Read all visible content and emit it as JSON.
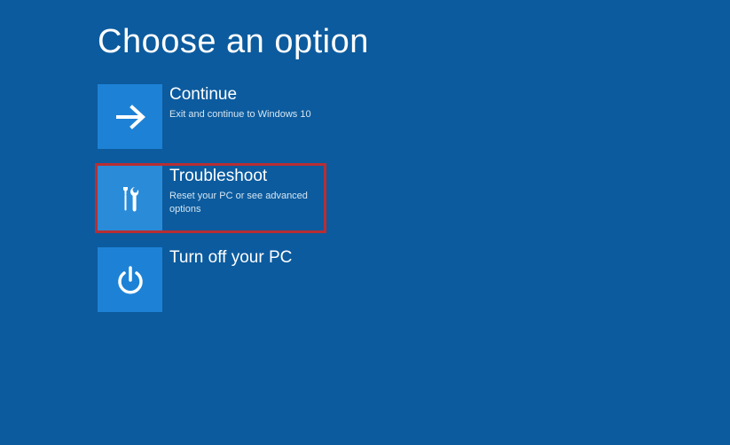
{
  "page": {
    "title": "Choose an option"
  },
  "options": {
    "continue": {
      "title": "Continue",
      "desc": "Exit and continue to Windows 10"
    },
    "troubleshoot": {
      "title": "Troubleshoot",
      "desc": "Reset your PC or see advanced options"
    },
    "turnoff": {
      "title": "Turn off your PC"
    }
  },
  "colors": {
    "background": "#0c5b9e",
    "tile": "#1d82d6",
    "highlight_border": "#b82e33"
  }
}
